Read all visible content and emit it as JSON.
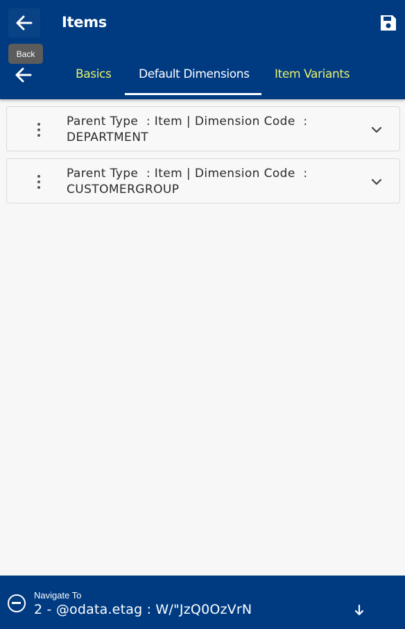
{
  "header": {
    "title": "Items",
    "back_icon": "arrow-left-icon",
    "save_icon": "floppy-disk-icon"
  },
  "tooltip": {
    "text": "Back"
  },
  "tabs": {
    "back_icon": "arrow-left-icon",
    "items": [
      {
        "label": "Basics",
        "active": false
      },
      {
        "label": "Default Dimensions",
        "active": true
      },
      {
        "label": "Item Variants",
        "active": false
      }
    ]
  },
  "list": {
    "items": [
      {
        "line1": "Parent Type  : Item | Dimension Code  :",
        "line2": "DEPARTMENT"
      },
      {
        "line1": "Parent Type  : Item | Dimension Code  :",
        "line2": "CUSTOMERGROUP"
      }
    ]
  },
  "bottom": {
    "label": "Navigate To",
    "value": "2 - @odata.etag : W/\"JzQ0OzVrN",
    "icon_left": "minus-circle-icon",
    "icon_right": "arrow-down-icon"
  },
  "colors": {
    "primary": "#003b82",
    "tab_inactive": "#e8f16a",
    "tab_active": "#ffffff",
    "background": "#f7f7f7"
  }
}
